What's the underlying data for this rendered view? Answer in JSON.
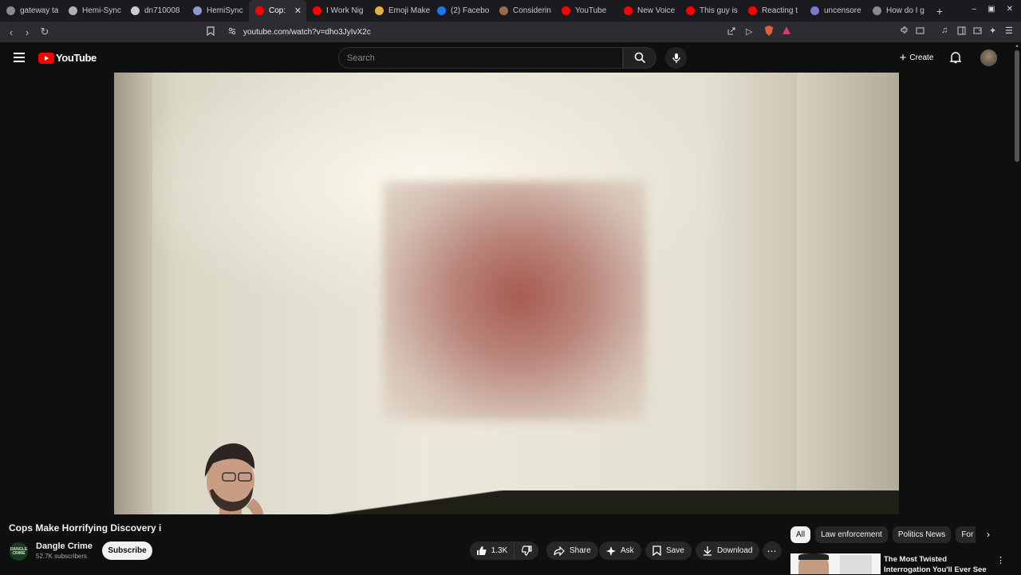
{
  "browser": {
    "tabs": [
      {
        "label": "gateway ta",
        "favicon_color": "#8a8a8a"
      },
      {
        "label": "Hemi-Sync",
        "favicon_color": "#b0b0b0"
      },
      {
        "label": "dn710008",
        "favicon_color": "#cccccc"
      },
      {
        "label": "HemiSync",
        "favicon_color": "#8c9ad0"
      },
      {
        "label": "Cop:",
        "favicon_color": "#ff0000",
        "active": true
      },
      {
        "label": "I Work Nig",
        "favicon_color": "#ff0000"
      },
      {
        "label": "Emoji Make",
        "favicon_color": "#e0b040"
      },
      {
        "label": "(2) Facebo",
        "favicon_color": "#1877f2"
      },
      {
        "label": "Considerin",
        "favicon_color": "#9a6a4a"
      },
      {
        "label": "YouTube",
        "favicon_color": "#ff0000"
      },
      {
        "label": "New Voice",
        "favicon_color": "#ff0000"
      },
      {
        "label": "This guy is",
        "favicon_color": "#ff0000"
      },
      {
        "label": "Reacting t",
        "favicon_color": "#ff0000"
      },
      {
        "label": "uncensore",
        "favicon_color": "#7a7ad0"
      },
      {
        "label": "How do I g",
        "favicon_color": "#8a8a8a"
      }
    ],
    "url": "youtube.com/watch?v=dho3JyIvX2c"
  },
  "header": {
    "logo_text": "YouTube",
    "search_placeholder": "Search",
    "create_label": "Create"
  },
  "video": {
    "title": "Cops Make Horrifying Discovery i",
    "channel_name": "Dangle Crime",
    "channel_avatar_text": "DANGLE CRIME",
    "subscribers": "52.7K subscribers",
    "subscribe_label": "Subscribe",
    "likes": "1.3K",
    "actions": {
      "share": "Share",
      "ask": "Ask",
      "save": "Save",
      "download": "Download"
    }
  },
  "chips": [
    {
      "label": "All",
      "active": true
    },
    {
      "label": "Law enforcement"
    },
    {
      "label": "Politics News"
    },
    {
      "label": "For y"
    }
  ],
  "recommendation": {
    "title": "The Most Twisted Interrogation You'll Ever See"
  }
}
